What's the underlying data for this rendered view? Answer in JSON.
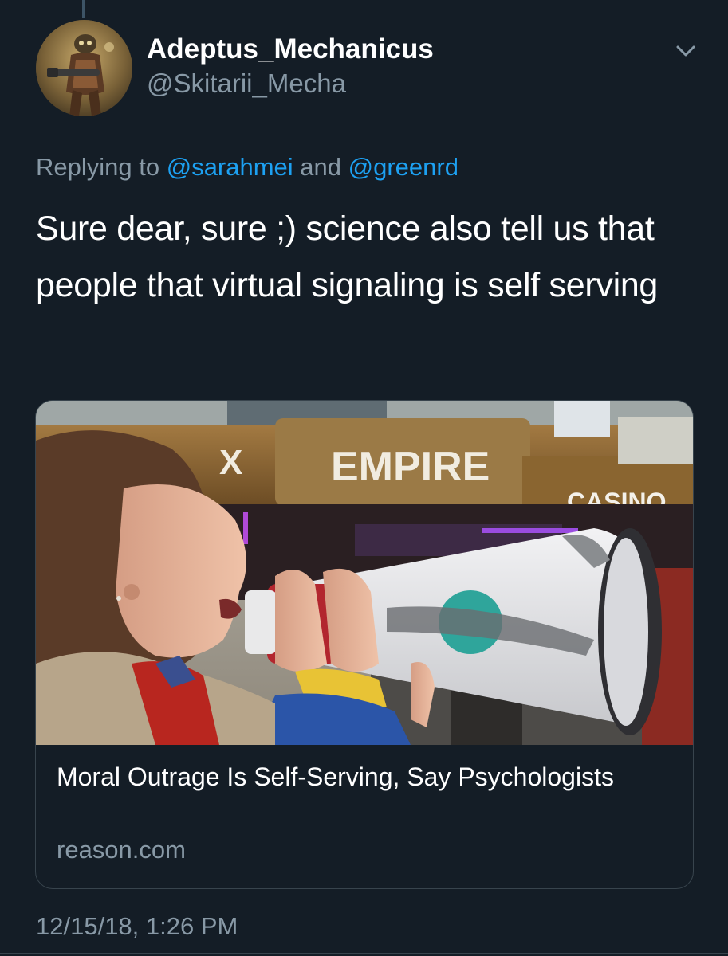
{
  "tweet": {
    "author": {
      "display_name": "Adeptus_Mechanicus",
      "handle": "@Skitarii_Mecha",
      "avatar_icon": "warrior-avatar"
    },
    "reply": {
      "prefix": "Replying to ",
      "mention1": "@sarahmei",
      "conjunction": " and ",
      "mention2": "@greenrd"
    },
    "text": "Sure dear, sure ;) science also tell us that people that virtual signaling is self serving",
    "card": {
      "sign_empire": "EMPIRE",
      "sign_casino": "CASINO",
      "sign_fragment": "X",
      "title": "Moral Outrage Is Self-Serving, Say Psychologists",
      "domain": "reason.com"
    },
    "timestamp": "12/15/18, 1:26 PM"
  },
  "colors": {
    "background": "#141d26",
    "text_primary": "#ffffff",
    "text_secondary": "#8899a6",
    "link": "#1da1f2",
    "border": "#38444d"
  }
}
